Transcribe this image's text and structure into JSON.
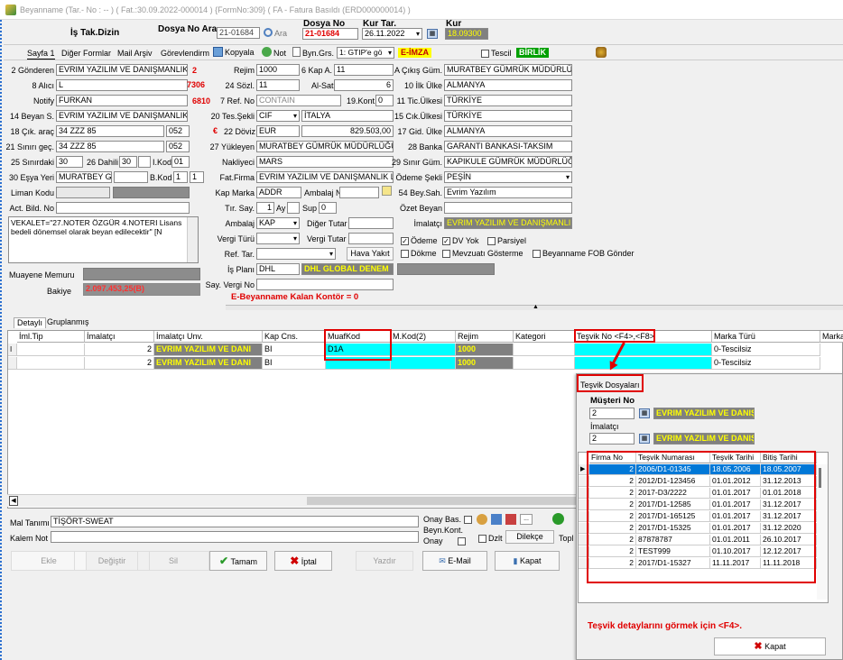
{
  "window": {
    "title": "Beyanname (Tar.- No : -- ) ( Fat.:30.09.2022-000014 ) {FormNo:309} ( FA - Fatura Basıldı (ERD000000014) )"
  },
  "top": {
    "is_tak": "İş Tak.Dizin",
    "dosya_ara_label": "Dosya No Ara",
    "dosya_ara_value": "21-01684",
    "ara_label": "Ara",
    "dosya_no_label": "Dosya No",
    "dosya_no_value": "21-01684",
    "kur_tar_label": "Kur Tar.",
    "kur_tar_value": "26.11.2022",
    "kur_label": "Kur",
    "kur_value": "18.09300"
  },
  "toolbar": {
    "sayfa": "Sayfa 1",
    "diger": "Diğer Formlar",
    "mail": "Mail Arşiv",
    "gorev": "Görevlendirme",
    "kopyala": "Kopyala",
    "not": "Not",
    "byn": "Byn.Grs.",
    "gtip": "1: GTIP'e gö",
    "eimza": "E-İMZA",
    "tescil": "Tescil",
    "birlik": "BİRLİK"
  },
  "form": {
    "gonderen_label": "2 Gönderen",
    "gonderen": "EVRIM YAZILIM VE DANIŞMANLIK L",
    "gonderen_no": "2",
    "alici_label": "8 Alıcı",
    "alici": "L",
    "alici_no": "7306",
    "notify_label": "Notify",
    "notify": "FURKAN",
    "notify_no": "6810",
    "beyan_label": "14 Beyan S.",
    "beyan": "EVRIM YAZILIM VE DANIŞMANLIK",
    "cik_arac_label": "18 Çık. araç",
    "cik_arac": "34 ZZZ 85",
    "cik_arac_code": "052",
    "sinir_gec_label": "21 Sınırı geç.",
    "sinir_gec": "34 ZZZ 85",
    "sinir_gec_code": "052",
    "sinirdaki_label": "25 Sınırdaki",
    "sinirdaki": "30",
    "dahili_label": "26 Dahili",
    "dahili": "30",
    "ikod_label": "I.Kod",
    "ikod": "01",
    "esya_label": "30 Eşya Yeri",
    "esya": "MURATBEY GÜ",
    "bkod_label": "B.Kod",
    "bkod1": "1",
    "bkod2": "1",
    "liman_label": "Liman Kodu",
    "act_label": "Act. Bild. No",
    "vekalet": "VEKALET=\"27.NOTER ÖZGÜR 4.NOTERI Lisans bedeli dönemsel olarak beyan edilecektir\" [N",
    "rejim_label": "Rejim",
    "rejim": "1000",
    "kap_a_label": "6 Kap A.",
    "kap_a": "11",
    "sozl_label": "24 Sözl.",
    "sozl": "11",
    "al_sat_label": "Al-Sat",
    "al_sat": "6",
    "ref_no_label": "7 Ref. No",
    "ref_no": "CONTAIN",
    "kont_label": "19.Kont.",
    "kont": "0",
    "tes_sekli_label": "20 Tes.Şekli",
    "tes_sekli": "CIF",
    "tes_ulke": "İTALYA",
    "doviz_symbol": "€",
    "doviz_label": "22 Döviz",
    "doviz": "EUR",
    "tutar": "829.503,00",
    "yukleyen_label": "27 Yükleyen",
    "yukleyen": "MURATBEY GÜMRÜK MÜDÜRLÜĞÜ",
    "nakliyeci_label": "Nakliyeci",
    "nakliyeci": "MARS",
    "fat_firma_label": "Fat.Firma",
    "fat_firma": "EVRIM YAZILIM VE DANIŞMANLIK LT",
    "kap_marka_label": "Kap Marka",
    "kap_marka": "ADDR",
    "ambalaj_no_label": "Ambalaj No",
    "tir_label": "Tır. Say.",
    "tir": "1",
    "ay_label": "Ay",
    "sup_label": "Sup",
    "sup": "0",
    "ambalaj_label": "Ambalaj",
    "ambalaj": "KAP",
    "diger_tutar_label": "Diğer Tutar",
    "vergi_turu_label": "Vergi Türü",
    "vergi_tutar_label": "Vergi Tutar",
    "ref_tar_label": "Ref. Tar.",
    "hava_yakit": "Hava Yakıt",
    "is_plani_label": "İş Planı",
    "is_plani": "DHL",
    "is_plani_name": "DHL GLOBAL DENEM",
    "say_vergi_label": "Say. Vergi No",
    "ekontor": "E-Beyanname Kalan Kontör = 0",
    "cikis_gum_label": "A Çıkış Güm.",
    "cikis_gum": "MURATBEY GÜMRÜK MÜDÜRLÜĞ",
    "ilk_ulke_label": "10 İlk Ülke",
    "ilk_ulke": "ALMANYA",
    "tic_ulke_label": "11 Tic.Ülkesi",
    "tic_ulke": "TÜRKİYE",
    "cik_ulke_label": "15 Cık.Ülkesi",
    "cik_ulke": "TÜRKİYE",
    "gid_ulke_label": "17 Gid. Ülke",
    "gid_ulke": "ALMANYA",
    "banka_label": "28 Banka",
    "banka": "GARANTI BANKASI-TAKSIM",
    "sinir_gum_label": "29 Sınır Güm.",
    "sinir_gum": "KAPIKULE GÜMRÜK MÜDÜRLÜĞ",
    "odeme_label": "Ödeme Şekli",
    "odeme": "PEŞİN",
    "bey_sah_label": "54 Bey.Sah.",
    "bey_sah": "Evrim Yazılım",
    "ozet_label": "Özet Beyan",
    "imalatci_label": "İmalatçı",
    "imalatci": "EVRIM YAZILIM VE DANIŞMANLIK",
    "cb_odeme": "Ödeme",
    "cb_dv": "DV Yok",
    "cb_parsiyel": "Parsiyel",
    "cb_dokme": "Dökme",
    "cb_mevzuat": "Mevzuatı Gösterme",
    "cb_fob": "Beyanname FOB Gönder",
    "muayene_label": "Muayene Memuru",
    "bakiye_label": "Bakiye",
    "bakiye": "2.097.453,25(B)"
  },
  "tabs": {
    "detayli": "Detaylı",
    "gruplanmis": "Gruplanmış"
  },
  "grid": {
    "headers": [
      "İml.Tip",
      "İmalatçı",
      "İmalatçı Unv.",
      "Kap Cns.",
      "MuafKod",
      "M.Kod(2)",
      "Rejim",
      "Kategori",
      "Teşvik No <F4>,<F8>",
      "Marka Türü",
      "Marka T"
    ],
    "rows": [
      {
        "mark": "I",
        "n": "2",
        "unv": "EVRIM YAZILIM VE DANI",
        "kap": "BI",
        "muaf": "D1A",
        "rejim": "1000",
        "marka": "0-Tescilsiz"
      },
      {
        "mark": "",
        "n": "2",
        "unv": "EVRIM YAZILIM VE DANI",
        "kap": "BI",
        "muaf": "",
        "rejim": "1000",
        "marka": "0-Tescilsiz"
      }
    ]
  },
  "bottom": {
    "mal_label": "Mal Tanımı",
    "mal": "TİŞÖRT-SWEAT",
    "kalem_label": "Kalem Not",
    "onay_bas": "Onay Bas.",
    "beyn_kont": "Beyn.Kont.",
    "onay": "Onay",
    "dzlt": "Dzlt",
    "dilekce": "Dilekçe",
    "topl": "Topl"
  },
  "buttons": {
    "ekle": "Ekle",
    "degistir": "Değiştir",
    "sil": "Sil",
    "tamam": "Tamam",
    "iptal": "İptal",
    "yazdir": "Yazdır",
    "email": "E-Mail",
    "kapat": "Kapat"
  },
  "popup": {
    "title": "Teşvik Dosyaları",
    "musteri_label": "Müşteri No",
    "musteri": "2",
    "musteri_name": "EVRIM YAZILIM VE DANIŞMA",
    "imalatci_label": "İmalatçı",
    "imalatci": "2",
    "imalatci_name": "EVRIM YAZILIM VE DANIŞMA",
    "headers": [
      "Firma No",
      "Teşvik Numarası",
      "Teşvik Tarihi",
      "Bitiş Tarihi"
    ],
    "rows": [
      [
        "2",
        "2006/D1-01345",
        "18.05.2006",
        "18.05.2007"
      ],
      [
        "2",
        "2012/D1-123456",
        "01.01.2012",
        "31.12.2013"
      ],
      [
        "2",
        "2017-D3/2222",
        "01.01.2017",
        "01.01.2018"
      ],
      [
        "2",
        "2017/D1-12585",
        "01.01.2017",
        "31.12.2017"
      ],
      [
        "2",
        "2017/D1-165125",
        "01.01.2017",
        "31.12.2017"
      ],
      [
        "2",
        "2017/D1-15325",
        "01.01.2017",
        "31.12.2020"
      ],
      [
        "2",
        "87878787",
        "01.01.2011",
        "26.10.2017"
      ],
      [
        "2",
        "TEST999",
        "01.10.2017",
        "12.12.2017"
      ],
      [
        "2",
        "2017/D1-15327",
        "11.11.2017",
        "11.11.2018"
      ]
    ],
    "hint": "Teşvik detaylarını görmek için <F4>.",
    "kapat": "Kapat"
  }
}
